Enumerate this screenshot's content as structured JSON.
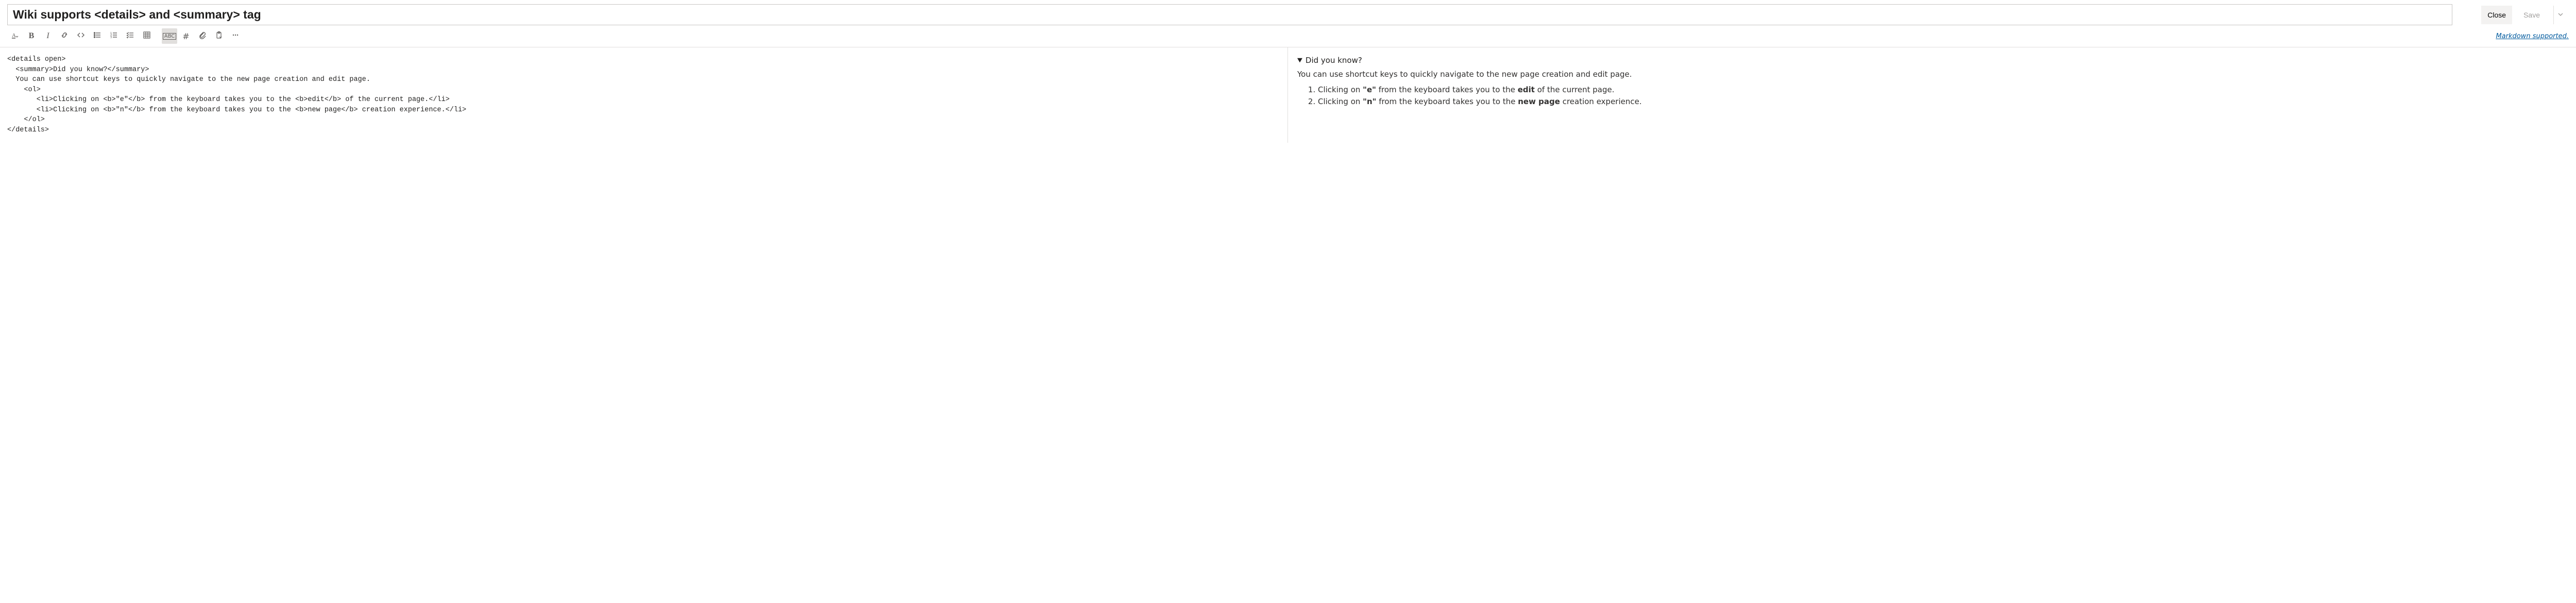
{
  "header": {
    "title_value": "Wiki supports <details> and <summary> tag",
    "close_label": "Close",
    "save_label": "Save"
  },
  "toolbar": {
    "markdown_link": "Markdown supported."
  },
  "source": {
    "code": "<details open>\n  <summary>Did you know?</summary>\n  You can use shortcut keys to quickly navigate to the new page creation and edit page.\n    <ol>\n       <li>Clicking on <b>\"e\"</b> from the keyboard takes you to the <b>edit</b> of the current page.</li>\n       <li>Clicking on <b>\"n\"</b> from the keyboard takes you to the <b>new page</b> creation experience.</li>\n    </ol>\n</details>"
  },
  "preview": {
    "summary": "Did you know?",
    "paragraph": "You can use shortcut keys to quickly navigate to the new page creation and edit page.",
    "item1_prefix": "Clicking on ",
    "item1_bold1": "\"e\"",
    "item1_mid": " from the keyboard takes you to the ",
    "item1_bold2": "edit",
    "item1_suffix": " of the current page.",
    "item2_prefix": "Clicking on ",
    "item2_bold1": "\"n\"",
    "item2_mid": " from the keyboard takes you to the ",
    "item2_bold2": "new page",
    "item2_suffix": " creation experience."
  }
}
